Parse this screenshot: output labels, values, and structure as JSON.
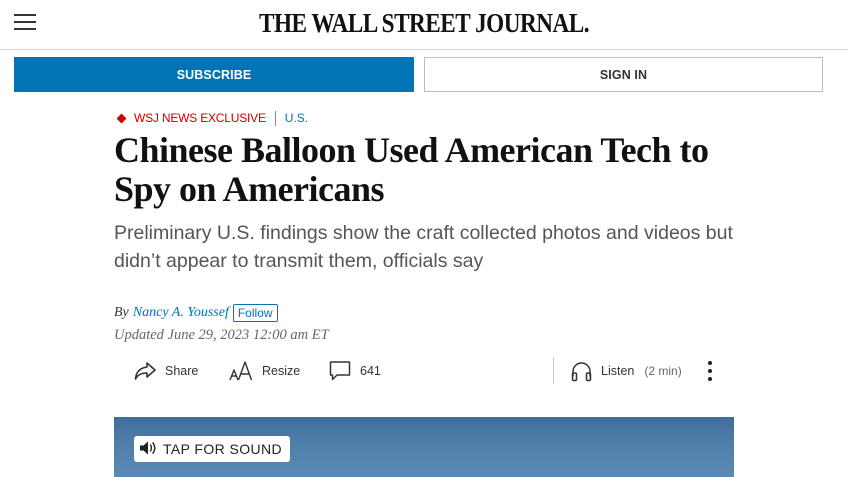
{
  "header": {
    "masthead": "THE WALL STREET JOURNAL.",
    "subscribe_label": "SUBSCRIBE",
    "signin_label": "SIGN IN"
  },
  "article": {
    "flashline": "WSJ NEWS EXCLUSIVE",
    "section": "U.S.",
    "headline": "Chinese Balloon Used American Tech to Spy on Americans",
    "dek": "Preliminary U.S. findings show the craft collected photos and videos but didn’t appear to transmit them, officials say",
    "byline_prefix": "By",
    "author": "Nancy A. Youssef",
    "follow_label": "Follow",
    "updated": "Updated June 29, 2023 12:00 am ET"
  },
  "tools": {
    "share_label": "Share",
    "resize_label": "Resize",
    "comment_count": "641",
    "listen_label": "Listen",
    "listen_duration": "(2 min)"
  },
  "media": {
    "sound_label": "TAP FOR SOUND"
  },
  "colors": {
    "brand_blue": "#0274b6",
    "exclusive_red": "#cc0000"
  },
  "icons": [
    "menu-icon",
    "share-icon",
    "resize-icon",
    "comment-icon",
    "headphones-icon",
    "more-icon",
    "speaker-icon"
  ]
}
